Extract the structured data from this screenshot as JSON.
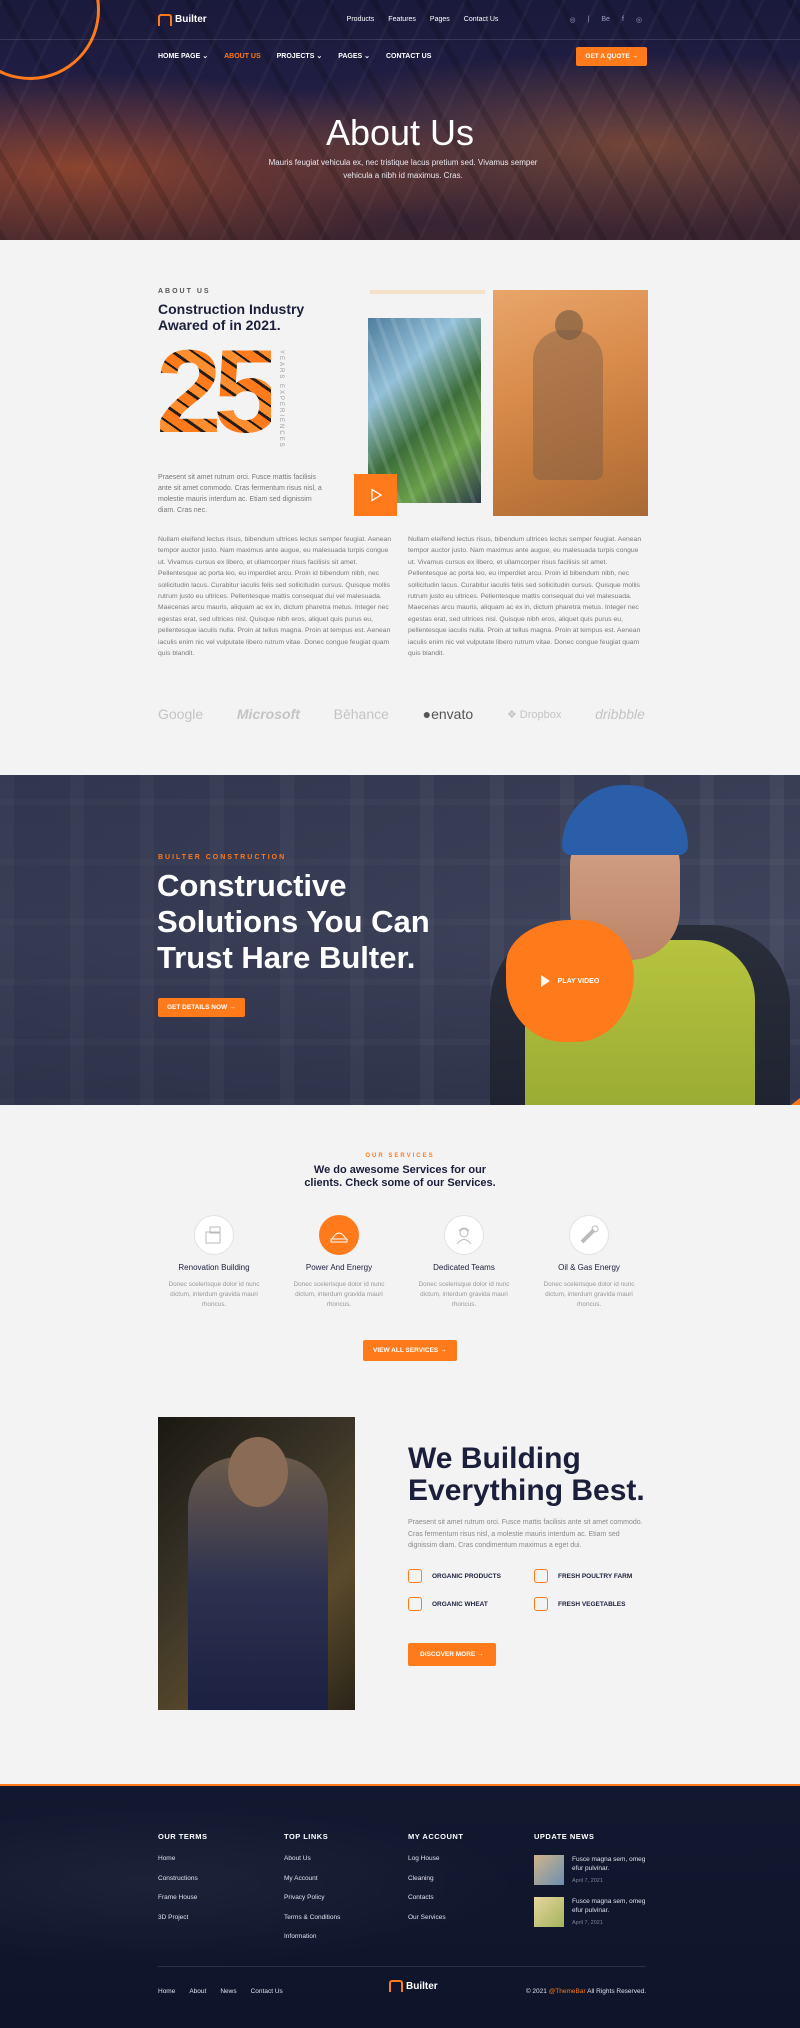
{
  "header": {
    "logo": "Builter",
    "top_nav": [
      "Products",
      "Features",
      "Pages",
      "Contact Us"
    ],
    "social": [
      "◎",
      "|",
      "Be",
      "f",
      "◎"
    ],
    "main_nav": [
      {
        "label": "HOME PAGE ⌄"
      },
      {
        "label": "ABOUT US",
        "active": true
      },
      {
        "label": "PROJECTS ⌄"
      },
      {
        "label": "PAGES ⌄"
      },
      {
        "label": "CONTACT US"
      }
    ],
    "cta": "GET A QUOTE →"
  },
  "hero": {
    "title": "About Us",
    "subtitle": "Mauris feugiat vehicula ex, nec tristique lacus pretium sed. Vivamus semper vehicula a nibh id maximus. Cras."
  },
  "about": {
    "eyebrow": "ABOUT US",
    "title": "Construction Industry Awared of in 2021.",
    "years_number": "25",
    "years_label": "YEARS EXPERIENCES",
    "intro": "Praesent sit amet rutrum orci. Fusce mattis facilisis ante sit amet commodo. Cras fermentum risus nisl, a molestie mauris interdum ac. Etiam sed dignissim diam. Cras nec.",
    "col1": "Nullam eleifend lectus risus, bibendum ultrices lectus semper feugiat. Aenean tempor auctor justo. Nam maximus ante augue, eu malesuada turpis congue ut. Vivamus cursus ex libero, et ullamcorper risus facilisis sit amet. Pellentesque ac porta leo, eu imperdiet arcu. Proin id bibendum nibh, nec sollicitudin lacus. Curabitur iaculis felis sed sollicitudin cursus. Quisque mollis rutrum justo eu ultrices. Pellentesque mattis consequat dui vel malesuada. Maecenas arcu mauris, aliquam ac ex in, dictum pharetra metus. Integer nec egestas erat, sed ultrices nisl. Quisque nibh eros, aliquet quis purus eu, pellentesque iaculis nulla. Proin at tellus magna. Proin at tempus est. Aenean iaculis enim nic vel vulputate libero rutrum vitae. Donec congue feugiat quam quis blandit.",
    "col2": "Nullam eleifend lectus risus, bibendum ultrices lectus semper feugiat. Aenean tempor auctor justo. Nam maximus ante augue, eu malesuada turpis congue ut. Vivamus cursus ex libero, et ullamcorper risus facilisis sit amet. Pellentesque ac porta leo, eu imperdiet arcu. Proin id bibendum nibh, nec sollicitudin lacus. Curabitur iaculis felis sed sollicitudin cursus. Quisque mollis rutrum justo eu ultrices. Pellentesque mattis consequat dui vel malesuada. Maecenas arcu mauris, aliquam ac ex in, dictum pharetra metus. Integer nec egestas erat, sed ultrices nisl. Quisque nibh eros, aliquet quis purus eu, pellentesque iaculis nulla. Proin at tellus magna. Proin at tempus est. Aenean iaculis enim nic vel vulputate libero rutrum vitae. Donec congue feugiat quam quis blandit."
  },
  "brands": [
    "Google",
    "Microsoft",
    "Bēhance",
    "●envato",
    "❖ Dropbox",
    "dribbble"
  ],
  "cta_section": {
    "eyebrow": "BUILTER CONSTRUCTION",
    "title": "Constructive Solutions You Can Trust Hare Bulter.",
    "button": "GET DETAILS NOW →",
    "play": "PLAY VIDEO"
  },
  "services": {
    "eyebrow": "OUR SERVICES",
    "title": "We do awesome Services for our clients. Check some of our Services.",
    "items": [
      {
        "name": "Renovation Building",
        "desc": "Donec scelerisque dolor id nunc dictum, interdum gravida mauri rhoncus.",
        "icon": "renovation-icon"
      },
      {
        "name": "Power And Energy",
        "desc": "Donec scelerisque dolor id nunc dictum, interdum gravida mauri rhoncus.",
        "icon": "power-icon",
        "active": true
      },
      {
        "name": "Dedicated Teams",
        "desc": "Donec scelerisque dolor id nunc dictum, interdum gravida mauri rhoncus.",
        "icon": "worker-icon"
      },
      {
        "name": "Oil & Gas Energy",
        "desc": "Donec scelerisque dolor id nunc dictum, interdum gravida mauri rhoncus.",
        "icon": "pipe-icon"
      }
    ],
    "button": "VIEW ALL SERVICES →"
  },
  "building": {
    "title": "We Building Everything Best.",
    "text": "Praesent sit amet rutrum orci. Fusce mattis facilisis ante sit amet commodo. Cras fermentum risus nisl, a molestie mauris interdum ac. Etiam sed dignissim diam. Cras condimentum maximus a eget dui.",
    "features": [
      "ORGANIC PRODUCTS",
      "FRESH POULTRY FARM",
      "ORGANIC WHEAT",
      "FRESH VEGETABLES"
    ],
    "button": "DISCOVER MORE →"
  },
  "footer": {
    "col1_title": "OUR TERMS",
    "col1_links": [
      "Home",
      "Constructions",
      "Frame House",
      "3D Project"
    ],
    "col2_title": "TOP LINKS",
    "col2_links": [
      "About Us",
      "My Account",
      "Privacy Policy",
      "Terms & Conditions",
      "Information"
    ],
    "col3_title": "MY ACCOUNT",
    "col3_links": [
      "Log House",
      "Cleaning",
      "Contacts",
      "Our Services"
    ],
    "col4_title": "UPDATE NEWS",
    "news": [
      {
        "text": "Fusce magna sem, omeg efur pulvinar.",
        "date": "April 7, 2021"
      },
      {
        "text": "Fusce magna sem, omeg efur pulvinar.",
        "date": "April 7, 2021"
      }
    ],
    "bottom_links": [
      "Home",
      "About",
      "News",
      "Contact Us"
    ],
    "copyright_prefix": "© 2021",
    "copyright_brand": "@ThemeBar",
    "copyright_suffix": "All Rights Reserved."
  },
  "colors": {
    "accent": "#ff7a1a",
    "navy": "#1b1f3b"
  }
}
